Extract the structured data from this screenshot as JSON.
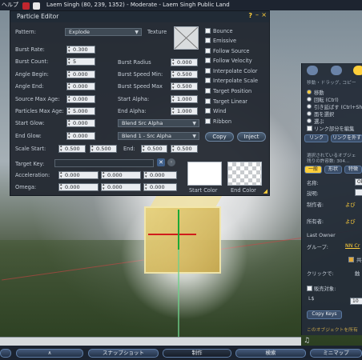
{
  "menubar": {
    "menu_label": "ヘルプ",
    "title": "Laem Singh (80, 239, 1352) - Moderate - Laem Singh Public Land"
  },
  "editor": {
    "title": "Particle Editor",
    "help": "?",
    "minimize": "–",
    "close": "×",
    "pattern_label": "Pattern:",
    "pattern_value": "Explode",
    "texture_label": "Texture",
    "burst_rate_label": "Burst Rate:",
    "burst_rate": "0.300",
    "burst_count_label": "Burst Count:",
    "burst_count": "5",
    "burst_radius_label": "Burst Radius",
    "burst_radius": "0.000",
    "angle_begin_label": "Angle Begin:",
    "angle_begin": "0.000",
    "burst_speed_min_label": "Burst Speed Min:",
    "burst_speed_min": "0.500",
    "angle_end_label": "Angle End:",
    "angle_end": "0.000",
    "burst_speed_max_label": "Burst Speed Max",
    "burst_speed_max": "0.500",
    "source_max_age_label": "Source Max Age:",
    "source_max_age": "0.000",
    "start_alpha_label": "Start Alpha:",
    "start_alpha": "1.000",
    "particles_max_age_label": "Particles Max Age:",
    "particles_max_age": "5.000",
    "end_alpha_label": "End Alpha:",
    "end_alpha": "1.000",
    "start_glow_label": "Start Glow:",
    "start_glow": "0.000",
    "blend_src_value": "Blend Src Alpha",
    "end_glow_label": "End Glow:",
    "end_glow": "0.000",
    "blend_dst_value": "Blend 1 - Src Alpha",
    "scale_start_label": "Scale Start:",
    "scale_start_x": "0.500",
    "scale_start_y": "0.500",
    "scale_end_label": "End:",
    "scale_end_x": "0.500",
    "scale_end_y": "0.500",
    "target_key_label": "Target Key:",
    "acceleration_label": "Acceleration:",
    "acc_x": "0.000",
    "acc_y": "0.000",
    "acc_z": "0.000",
    "omega_label": "Omega:",
    "omega_x": "0.000",
    "omega_y": "0.000",
    "omega_z": "0.000",
    "start_color_label": "Start Color",
    "end_color_label": "End Color",
    "flags": [
      "Bounce",
      "Emissive",
      "Follow Source",
      "Follow Velocity",
      "Interpolate Color",
      "Interpolate Scale",
      "Target Position",
      "Target Linear",
      "Wind",
      "Ribbon"
    ],
    "copy_label": "Copy",
    "inject_label": "Inject"
  },
  "right_panel": {
    "hint": "移動・ドラッグ, コピー",
    "radios": [
      "移動",
      "回転 (Ctrl)",
      "引き延ばす (Ctrl+Sh",
      "面を選択",
      "選ぶ",
      "リンク部分を編集"
    ],
    "tab_link": "リンク",
    "tab_link2": "リンクを外す",
    "selected_info": "選択されているオブジェ",
    "prim_count": "残りの許容数: 304...",
    "tabs": [
      "一般",
      "形状",
      "特徴"
    ],
    "name_label": "名称:",
    "name_value": "Ob",
    "desc_label": "説明:",
    "creator_label": "制作者:",
    "creator_value": "よび",
    "owner_label": "所有者:",
    "owner_value": "よび",
    "last_owner_label": "Last Owner",
    "group_label": "グループ:",
    "group_value": "NN Cr",
    "share_label": "共有",
    "click_label": "クリックで:",
    "click_value": "触",
    "for_sale_label": "販売対象:",
    "price_label": "L$",
    "price_value": "10",
    "copy_keys_label": "Copy Keys",
    "note": "このオブジェクトを所有"
  },
  "bottom_bar": {
    "btn_chevron": "∧",
    "btn_snapshot": "スナップショット",
    "btn_build": "制作",
    "btn_search": "検索",
    "btn_minimap": "ミニマップ"
  },
  "colors": {
    "accent": "#ffcf3a",
    "panel_bg": "#20262e",
    "button_blue": "#4f6379"
  }
}
